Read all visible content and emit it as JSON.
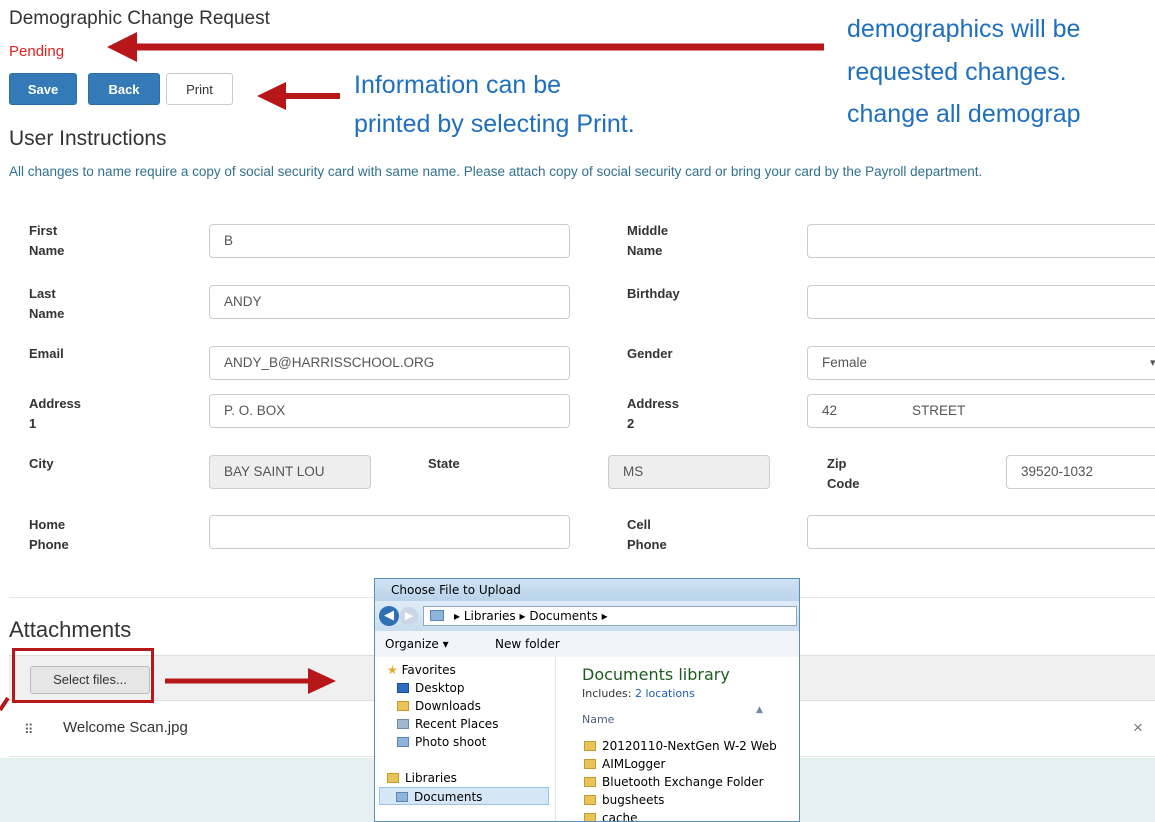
{
  "page": {
    "title": "Demographic Change Request",
    "status": "Pending",
    "buttons": {
      "save": "Save",
      "back": "Back",
      "print": "Print"
    },
    "instructions_heading": "User Instructions",
    "instructions_text": "All changes to name require a copy of social security card with same name. Please attach copy of social security card or bring your card by the Payroll department."
  },
  "form": {
    "first_name": {
      "label1": "First",
      "label2": "Name",
      "value": "B"
    },
    "middle_name": {
      "label1": "Middle",
      "label2": "Name",
      "value": ""
    },
    "last_name": {
      "label1": "Last",
      "label2": "Name",
      "value": "ANDY"
    },
    "birthday": {
      "label": "Birthday",
      "value": ""
    },
    "email": {
      "label": "Email",
      "value": "ANDY_B@HARRISSCHOOL.ORG"
    },
    "gender": {
      "label": "Gender",
      "value": "Female"
    },
    "address1": {
      "label1": "Address",
      "label2": "1",
      "value": "P. O. BOX"
    },
    "address2": {
      "label1": "Address",
      "label2": "2",
      "value": "42                    STREET"
    },
    "city": {
      "label": "City",
      "value": "BAY SAINT LOU"
    },
    "state": {
      "label": "State",
      "value": "MS"
    },
    "zip": {
      "label1": "Zip",
      "label2": "Code",
      "value": "39520-1032"
    },
    "home_phone": {
      "label1": "Home",
      "label2": "Phone",
      "value": ""
    },
    "cell_phone": {
      "label1": "Cell",
      "label2": "Phone",
      "value": ""
    }
  },
  "attachments": {
    "heading": "Attachments",
    "select_files": "Select files...",
    "file_name": "Welcome Scan.jpg",
    "remove": "×"
  },
  "annotations": {
    "print_note_line1": "Information can be",
    "print_note_line2": "printed by selecting Print.",
    "top_right_line1": "demographics will be",
    "top_right_line2": "requested changes.",
    "top_right_line3": "change all demograp"
  },
  "dialog": {
    "title": "Choose File to Upload",
    "breadcrumb": [
      "Libraries",
      "Documents"
    ],
    "organize": "Organize ▾",
    "new_folder": "New folder",
    "nav": {
      "favorites": "Favorites",
      "desktop": "Desktop",
      "downloads": "Downloads",
      "recent_places": "Recent Places",
      "photo_shoot": "Photo shoot",
      "libraries": "Libraries",
      "documents": "Documents"
    },
    "library_title": "Documents library",
    "includes_prefix": "Includes: ",
    "includes_link": "2 locations",
    "column_name": "Name",
    "files": [
      "20120110-NextGen W-2 Web",
      "AIMLogger",
      "Bluetooth Exchange Folder",
      "bugsheets",
      "cache"
    ]
  },
  "colors": {
    "primary": "#337ab7",
    "status_red": "#e02020",
    "info_text": "#31708f",
    "annotation_blue": "#1f6fbf",
    "arrow_red": "#b8171a"
  }
}
